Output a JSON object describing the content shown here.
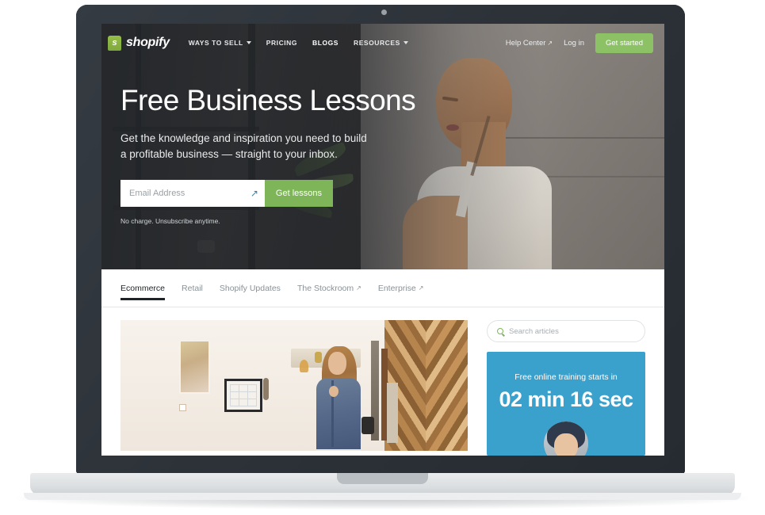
{
  "device": {
    "type": "laptop-mockup"
  },
  "site": {
    "brand": {
      "bag_letter": "s",
      "wordmark": "shopify"
    },
    "nav": {
      "links": [
        {
          "label": "WAYS TO SELL",
          "has_caret": true,
          "active": false
        },
        {
          "label": "PRICING",
          "has_caret": false,
          "active": false
        },
        {
          "label": "BLOGS",
          "has_caret": false,
          "active": true
        },
        {
          "label": "RESOURCES",
          "has_caret": true,
          "active": false
        }
      ],
      "help_center": "Help Center",
      "help_center_arrow": "↗",
      "log_in": "Log in",
      "get_started": "Get started"
    },
    "hero": {
      "title": "Free Business Lessons",
      "subtitle": "Get the knowledge and inspiration you need to build a profitable business — straight to your inbox.",
      "email_placeholder": "Email Address",
      "email_value": "",
      "email_icon_glyph": "↗",
      "submit_label": "Get lessons",
      "disclaimer": "No charge. Unsubscribe anytime."
    },
    "tabs": [
      {
        "label": "Ecommerce",
        "external": false,
        "active": true
      },
      {
        "label": "Retail",
        "external": false,
        "active": false
      },
      {
        "label": "Shopify Updates",
        "external": false,
        "active": false
      },
      {
        "label": "The Stockroom",
        "external": true,
        "active": false
      },
      {
        "label": "Enterprise",
        "external": true,
        "active": false
      }
    ],
    "external_arrow": "↗",
    "sidebar": {
      "search_placeholder": "Search articles",
      "search_value": "",
      "promo": {
        "label": "Free online training starts in",
        "countdown": "02 min 16 sec"
      }
    }
  },
  "colors": {
    "brand_green": "#96bf48",
    "button_green": "#8cc265",
    "form_button_green": "#7fb559",
    "promo_blue": "#3aa0cc",
    "bezel": "#2e343a",
    "base_gray": "#dcdfe1",
    "text_dark": "#1f2326",
    "text_muted": "#8a9196"
  }
}
